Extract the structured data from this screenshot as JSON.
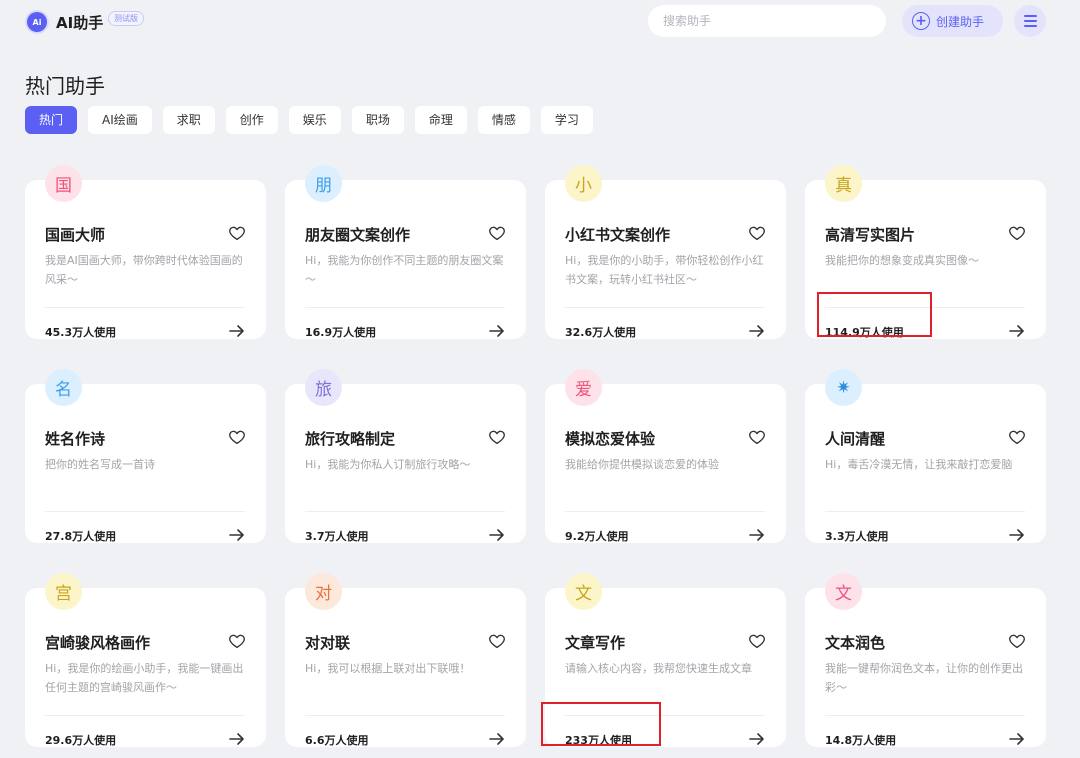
{
  "header": {
    "logo_icon_text": "Ai",
    "app_name": "AI助手",
    "badge": "测试版",
    "search_placeholder": "搜索助手",
    "create_label": "创建助手"
  },
  "page_title": "热门助手",
  "tabs": [
    "热门",
    "AI绘画",
    "求职",
    "创作",
    "娱乐",
    "职场",
    "命理",
    "情感",
    "学习"
  ],
  "cards": [
    {
      "avatar": "国",
      "avatar_bg": "#fde2ea",
      "avatar_color": "#f0527a",
      "title": "国画大师",
      "desc": "我是AI国画大师，带你跨时代体验国画的风采～",
      "usage": "45.3万人使用"
    },
    {
      "avatar": "朋",
      "avatar_bg": "#dcefff",
      "avatar_color": "#3c9ee8",
      "title": "朋友圈文案创作",
      "desc": "Hi，我能为你创作不同主题的朋友圈文案～",
      "usage": "16.9万人使用"
    },
    {
      "avatar": "小",
      "avatar_bg": "#fbf5c9",
      "avatar_color": "#c8a51c",
      "title": "小红书文案创作",
      "desc": "Hi，我是你的小助手，带你轻松创作小红书文案，玩转小红书社区～",
      "usage": "32.6万人使用"
    },
    {
      "avatar": "真",
      "avatar_bg": "#fbf5c9",
      "avatar_color": "#c8a51c",
      "title": "高清写实图片",
      "desc": "我能把你的想象变成真实图像～",
      "usage": "114.9万人使用"
    },
    {
      "avatar": "名",
      "avatar_bg": "#dcefff",
      "avatar_color": "#3c9ee8",
      "title": "姓名作诗",
      "desc": "把你的姓名写成一首诗",
      "usage": "27.8万人使用"
    },
    {
      "avatar": "旅",
      "avatar_bg": "#e8e6fb",
      "avatar_color": "#7b72d9",
      "title": "旅行攻略制定",
      "desc": "Hi，我能为你私人订制旅行攻略～",
      "usage": "3.7万人使用"
    },
    {
      "avatar": "爱",
      "avatar_bg": "#fde2ea",
      "avatar_color": "#f0527a",
      "title": "模拟恋爱体验",
      "desc": "我能给你提供模拟谈恋爱的体验",
      "usage": "9.2万人使用"
    },
    {
      "avatar": "✷",
      "avatar_bg": "#dcefff",
      "avatar_color": "#2f8de0",
      "title": "人间清醒",
      "desc": "Hi，毒舌冷漠无情，让我来敲打恋爱脑",
      "usage": "3.3万人使用"
    },
    {
      "avatar": "宫",
      "avatar_bg": "#fbf5c9",
      "avatar_color": "#c8a51c",
      "title": "宫崎骏风格画作",
      "desc": "Hi，我是你的绘画小助手，我能一键画出任何主题的宫崎骏风画作～",
      "usage": "29.6万人使用"
    },
    {
      "avatar": "对",
      "avatar_bg": "#fde8dc",
      "avatar_color": "#e8743c",
      "title": "对对联",
      "desc": "Hi，我可以根据上联对出下联哦！",
      "usage": "6.6万人使用"
    },
    {
      "avatar": "文",
      "avatar_bg": "#fbf5c9",
      "avatar_color": "#c8a51c",
      "title": "文章写作",
      "desc": "请输入核心内容，我帮您快速生成文章",
      "usage": "233万人使用"
    },
    {
      "avatar": "文",
      "avatar_bg": "#fde2ea",
      "avatar_color": "#f0527a",
      "title": "文本润色",
      "desc": "我能一键帮你润色文本，让你的创作更出彩～",
      "usage": "14.8万人使用"
    }
  ],
  "colors": {
    "accent": "#5b5ff3",
    "highlight": "#e0202a"
  }
}
